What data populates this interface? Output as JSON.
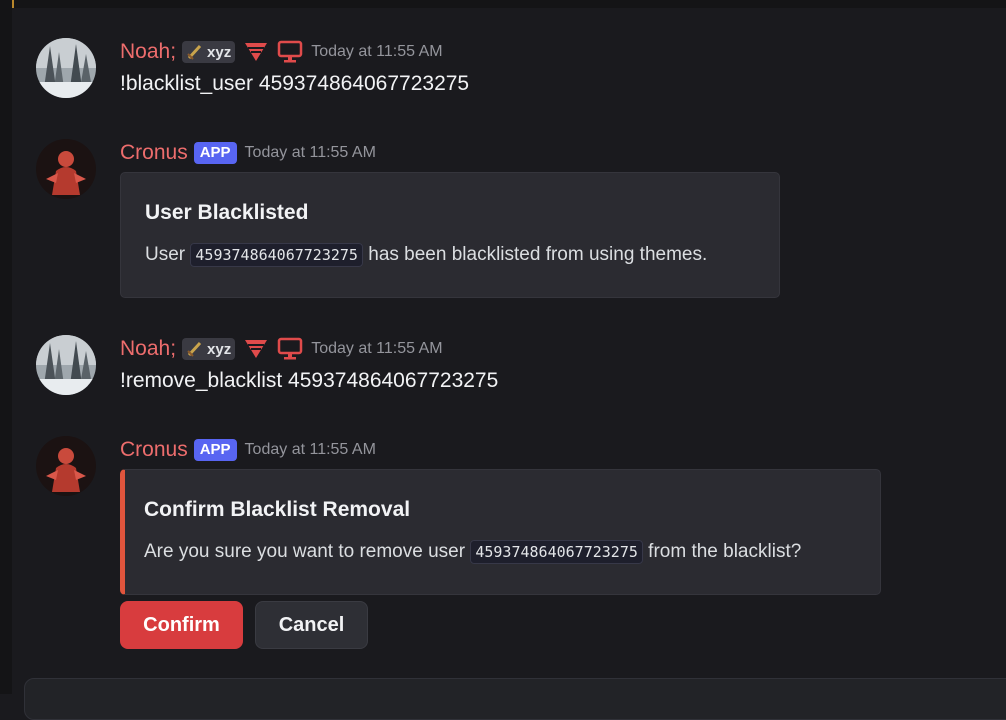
{
  "messages": [
    {
      "username": "Noah;",
      "tag": "xyz",
      "timestamp": "Today at 11:55 AM",
      "text": "!blacklist_user 459374864067723275"
    },
    {
      "username": "Cronus",
      "badge": "APP",
      "timestamp": "Today at 11:55 AM",
      "embed": {
        "title": "User Blacklisted",
        "desc_before": "User",
        "code": "459374864067723275",
        "desc_after": "has been blacklisted from using themes."
      }
    },
    {
      "username": "Noah;",
      "tag": "xyz",
      "timestamp": "Today at 11:55 AM",
      "text": "!remove_blacklist 459374864067723275"
    },
    {
      "username": "Cronus",
      "badge": "APP",
      "timestamp": "Today at 11:55 AM",
      "embed": {
        "title": "Confirm Blacklist Removal",
        "desc_before": "Are you sure you want to remove user",
        "code": "459374864067723275",
        "desc_after": "from the blacklist?"
      },
      "buttons": {
        "confirm": "Confirm",
        "cancel": "Cancel"
      }
    }
  ],
  "colors": {
    "username": "#ed6d6d",
    "app_badge": "#5865f2",
    "embed_accent": "#e0553d",
    "confirm_button": "#d83c3e",
    "background": "#1a1a1e"
  },
  "icons": [
    "avatar-noah-snowy-forest",
    "avatar-cronus-red-figure",
    "sword-icon",
    "hypesquad-icon",
    "desktop-icon"
  ]
}
